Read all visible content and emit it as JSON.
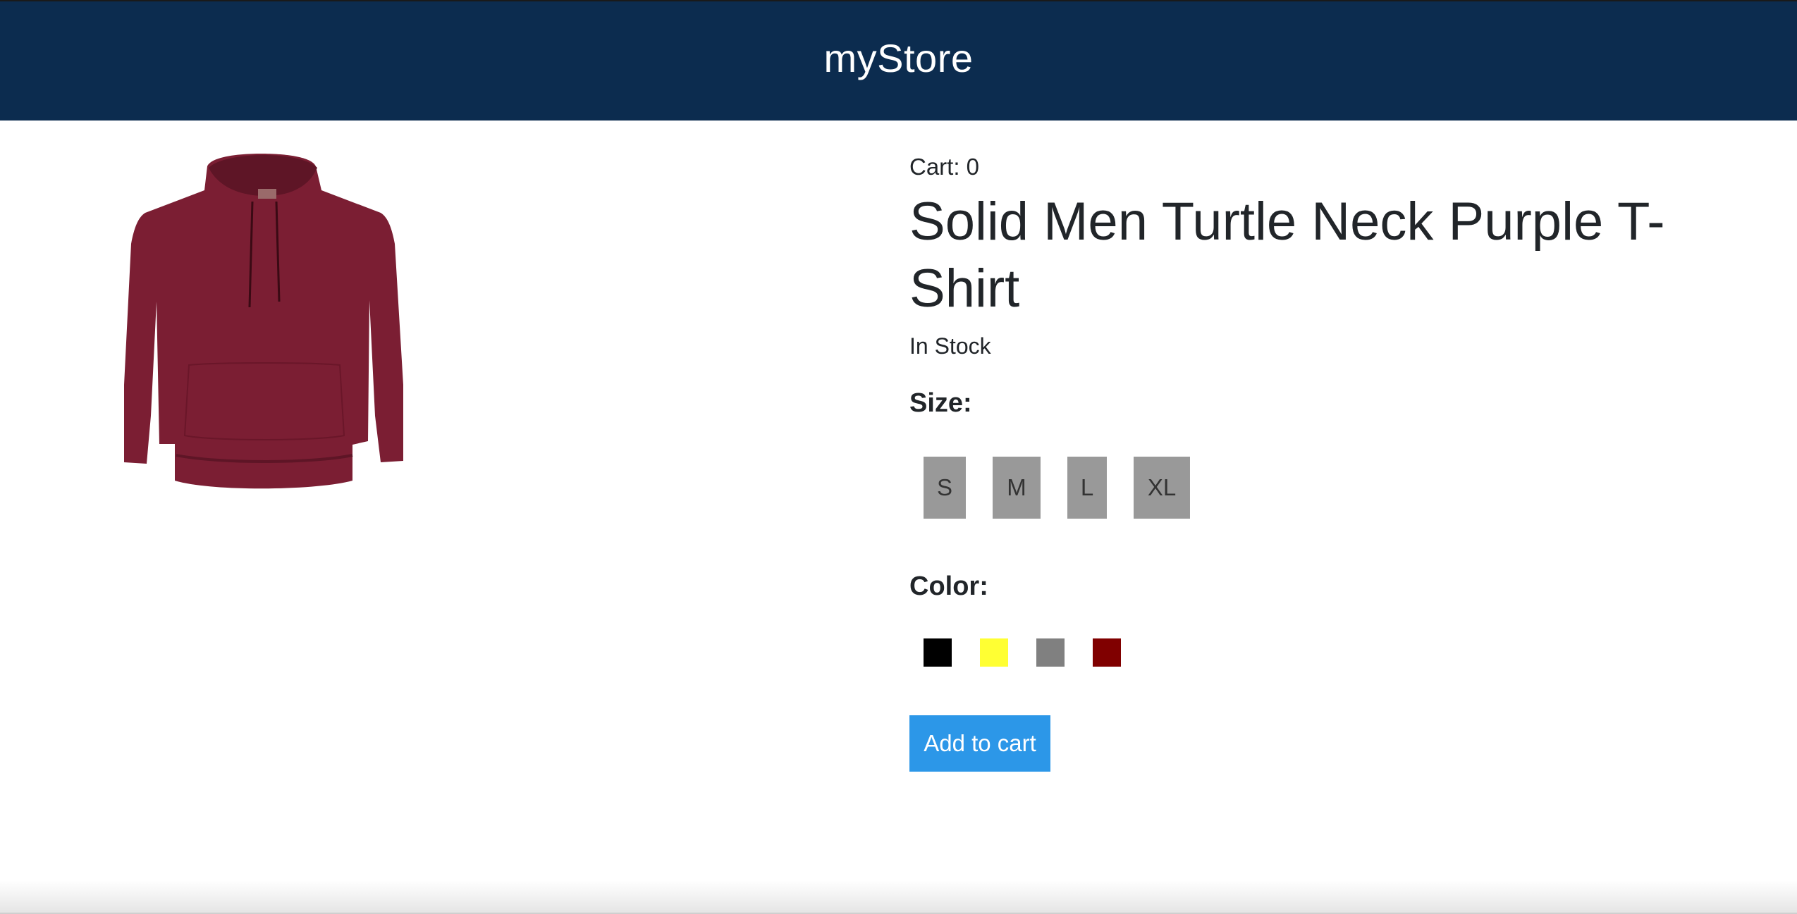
{
  "header": {
    "brand": "myStore"
  },
  "product": {
    "image_alt": "maroon hoodie",
    "cart_text": "Cart: 0",
    "title": "Solid Men Turtle Neck Purple T-Shirt",
    "stock_status": "In Stock",
    "size_label": "Size:",
    "sizes": [
      "S",
      "M",
      "L",
      "XL"
    ],
    "color_label": "Color:",
    "colors": [
      "#000000",
      "#ffff33",
      "#808080",
      "#800000"
    ],
    "add_to_cart_label": "Add to cart"
  }
}
